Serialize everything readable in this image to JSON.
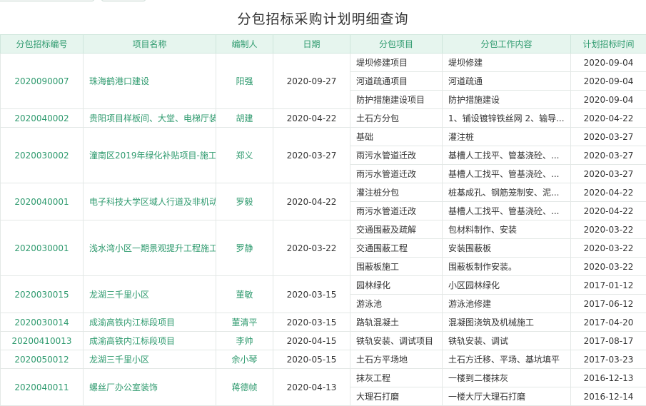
{
  "title": "分包招标采购计划明细查询",
  "columns": [
    "分包招标编号",
    "项目名称",
    "编制人",
    "日期",
    "分包项目",
    "分包工作内容",
    "计划招标时间"
  ],
  "groups": [
    {
      "code": "2020090007",
      "name": "珠海鹤港口建设",
      "maker": "阳强",
      "date": "2020-09-27",
      "items": [
        [
          "堤坝修建项目",
          "堤坝修建",
          "2020-09-04"
        ],
        [
          "河道疏通项目",
          "河道疏通",
          "2020-09-04"
        ],
        [
          "防护措施建设项目",
          "防护措施建设",
          "2020-09-04"
        ]
      ]
    },
    {
      "code": "2020040002",
      "name": "贵阳项目样板间、大堂、电梯厅装",
      "maker": "胡建",
      "date": "2020-04-22",
      "items": [
        [
          "土石方分包",
          "1、铺设镀锌铁丝网 2、输导...",
          "2020-04-22"
        ]
      ]
    },
    {
      "code": "2020030002",
      "name": "潼南区2019年绿化补贴项目-施工",
      "maker": "郑义",
      "date": "2020-03-27",
      "items": [
        [
          "基础",
          "灌注桩",
          "2020-03-27"
        ],
        [
          "雨污水管道迁改",
          "基槽人工找平、管基浇砼、...",
          "2020-03-27"
        ],
        [
          "雨污水管道迁改",
          "基槽人工找平、管基浇砼、...",
          "2020-03-27"
        ]
      ]
    },
    {
      "code": "2020040001",
      "name": "电子科技大学区域人行道及非机动",
      "maker": "罗毅",
      "date": "2020-04-22",
      "items": [
        [
          "灌注桩分包",
          "桩基成孔、钢筋笼制安、泥...",
          "2020-04-22"
        ],
        [
          "雨污水管道迁改",
          "基槽人工找平、管基浇砼、...",
          "2020-04-22"
        ]
      ]
    },
    {
      "code": "2020030001",
      "name": "浅水湾小区一期景观提升工程施工",
      "maker": "罗静",
      "date": "2020-03-22",
      "items": [
        [
          "交通围蔽及疏解",
          "包材料制作、安装",
          "2020-03-22"
        ],
        [
          "交通围蔽工程",
          "安装围蔽板",
          "2020-03-22"
        ],
        [
          "围蔽板施工",
          "围蔽板制作安装。",
          "2020-03-22"
        ]
      ]
    },
    {
      "code": "2020030015",
      "name": "龙湖三千里小区",
      "maker": "董敏",
      "date": "2020-03-15",
      "items": [
        [
          "园林绿化",
          "小区园林绿化",
          "2017-01-12"
        ],
        [
          "游泳池",
          "游泳池修建",
          "2017-06-12"
        ]
      ]
    },
    {
      "code": "2020030014",
      "name": "成渝高铁内江标段项目",
      "maker": "董清平",
      "date": "2020-03-15",
      "items": [
        [
          "路轨混凝土",
          "混凝图浇筑及机械施工",
          "2017-04-20"
        ]
      ]
    },
    {
      "code": "20200410013",
      "name": "成渝高铁内江标段项目",
      "maker": "李帅",
      "date": "2020-04-15",
      "items": [
        [
          "铁轨安装、调试项目",
          "铁轨安装、调试",
          "2017-08-17"
        ]
      ]
    },
    {
      "code": "2020050012",
      "name": "龙湖三千里小区",
      "maker": "余小琴",
      "date": "2020-05-15",
      "items": [
        [
          "土石方平场地",
          "土石方迁移、平场、基坑填平",
          "2017-03-23"
        ]
      ]
    },
    {
      "code": "2020040011",
      "name": "螺丝厂办公室装饰",
      "maker": "蒋德帧",
      "date": "2020-04-13",
      "items": [
        [
          "抹灰工程",
          "一楼到二楼抹灰",
          "2016-12-13"
        ],
        [
          "大理石打磨",
          "一楼大厅大理石打磨",
          "2016-12-14"
        ]
      ]
    }
  ]
}
